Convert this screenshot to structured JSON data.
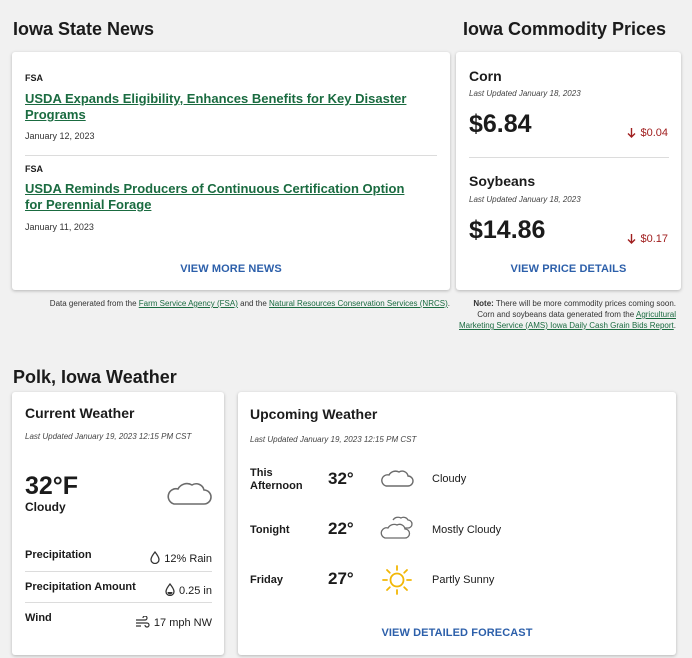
{
  "news": {
    "title": "Iowa State News",
    "items": [
      {
        "agency": "FSA",
        "headline": "USDA Expands Eligibility, Enhances Benefits for Key Disaster Programs",
        "date": "January 12, 2023"
      },
      {
        "agency": "FSA",
        "headline": "USDA Reminds Producers of Continuous Certification Option for Perennial Forage",
        "date": "January 11, 2023"
      }
    ],
    "view_more": "VIEW MORE NEWS",
    "footnote": {
      "prefix": "Data generated from the ",
      "link1": "Farm Service Agency (FSA)",
      "middle": " and the ",
      "link2": "Natural Resources Conservation Services (NRCS)",
      "suffix": "."
    }
  },
  "commodities": {
    "title": "Iowa Commodity Prices",
    "items": [
      {
        "name": "Corn",
        "updated": "Last Updated January 18, 2023",
        "price": "$6.84",
        "change": "$0.04",
        "direction": "down"
      },
      {
        "name": "Soybeans",
        "updated": "Last Updated January 18, 2023",
        "price": "$14.86",
        "change": "$0.17",
        "direction": "down"
      }
    ],
    "view_details": "VIEW PRICE DETAILS",
    "note": {
      "label": "Note:",
      "text1": " There will be more commodity prices coming soon.",
      "text2": "Corn and soybeans data generated from the ",
      "link": "Agricultural Marketing Service (AMS) Iowa Daily Cash Grain Bids Report",
      "suffix": "."
    },
    "negative_color": "#a01e1e"
  },
  "weather": {
    "title": "Polk, Iowa Weather",
    "current": {
      "heading": "Current Weather",
      "updated": "Last Updated January 19, 2023 12:15 PM CST",
      "temp": "32°F",
      "condition": "Cloudy",
      "icon": "cloud-icon",
      "rows": [
        {
          "label": "Precipitation",
          "icon": "raindrop-icon",
          "value": "12% Rain"
        },
        {
          "label": "Precipitation Amount",
          "icon": "water-drop-icon",
          "value": "0.25 in"
        },
        {
          "label": "Wind",
          "icon": "wind-icon",
          "value": "17 mph NW"
        }
      ]
    },
    "upcoming": {
      "heading": "Upcoming Weather",
      "updated": "Last Updated January 19, 2023 12:15 PM CST",
      "periods": [
        {
          "period_line1": "This",
          "period_line2": "Afternoon",
          "temp": "32°",
          "icon": "cloud-icon",
          "condition": "Cloudy"
        },
        {
          "period_line1": "Tonight",
          "period_line2": "",
          "temp": "22°",
          "icon": "mostly-cloudy-icon",
          "condition": "Mostly Cloudy"
        },
        {
          "period_line1": "Friday",
          "period_line2": "",
          "temp": "27°",
          "icon": "sun-icon",
          "condition": "Partly Sunny"
        }
      ],
      "view_forecast": "VIEW DETAILED FORECAST"
    }
  },
  "colors": {
    "link_green": "#1a6b40",
    "cta_blue": "#2c5faa",
    "sun_yellow": "#f2b705"
  }
}
